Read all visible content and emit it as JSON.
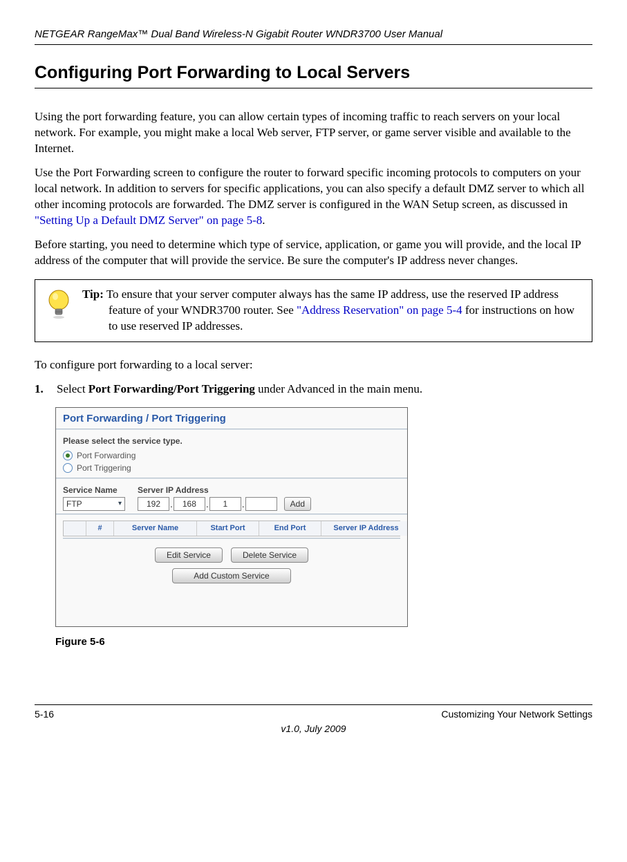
{
  "header": {
    "manual_title": "NETGEAR RangeMax™ Dual Band Wireless-N Gigabit Router WNDR3700 User Manual"
  },
  "section": {
    "title": "Configuring Port Forwarding to Local Servers",
    "para1": "Using the port forwarding feature, you can allow certain types of incoming traffic to reach servers on your local network. For example, you might make a local Web server, FTP server, or game server visible and available to the Internet.",
    "para2_a": "Use the Port Forwarding screen to configure the router to forward specific incoming protocols to computers on your local network. In addition to servers for specific applications, you can also specify a default DMZ server to which all other incoming protocols are forwarded. The DMZ server is configured in the WAN Setup screen, as discussed in ",
    "para2_link": "\"Setting Up a Default DMZ Server\" on page 5-8",
    "para2_b": ".",
    "para3": "Before starting, you need to determine which type of service, application, or game you will provide, and the local IP address of the computer that will provide the service. Be sure the computer's IP address never changes."
  },
  "tip": {
    "label": "Tip:",
    "text_a": " To ensure that your server computer always has the same IP address, use the reserved IP address feature of your WNDR3700 router. See ",
    "link": "\"Address Reservation\" on page 5-4",
    "text_b": " for instructions on how to use reserved IP addresses."
  },
  "steps": {
    "intro": "To configure port forwarding to a local server:",
    "num1": "1.",
    "step1_a": "Select ",
    "step1_bold": "Port Forwarding/Port Triggering",
    "step1_b": " under Advanced in the main menu."
  },
  "ui": {
    "panel_title": "Port Forwarding / Port Triggering",
    "select_label": "Please select the service type.",
    "radio1": "Port Forwarding",
    "radio2": "Port Triggering",
    "service_name_label": "Service Name",
    "server_ip_label": "Server IP Address",
    "service_value": "FTP",
    "ip": {
      "o1": "192",
      "o2": "168",
      "o3": "1",
      "o4": ""
    },
    "add_btn": "Add",
    "table": {
      "c0": "",
      "c1": "#",
      "c2": "Server Name",
      "c3": "Start Port",
      "c4": "End Port",
      "c5": "Server IP Address"
    },
    "btn_edit": "Edit Service",
    "btn_delete": "Delete Service",
    "btn_add_custom": "Add Custom Service"
  },
  "figure_caption": "Figure 5-6",
  "footer": {
    "page": "5-16",
    "right": "Customizing Your Network Settings",
    "center": "v1.0, July 2009"
  }
}
